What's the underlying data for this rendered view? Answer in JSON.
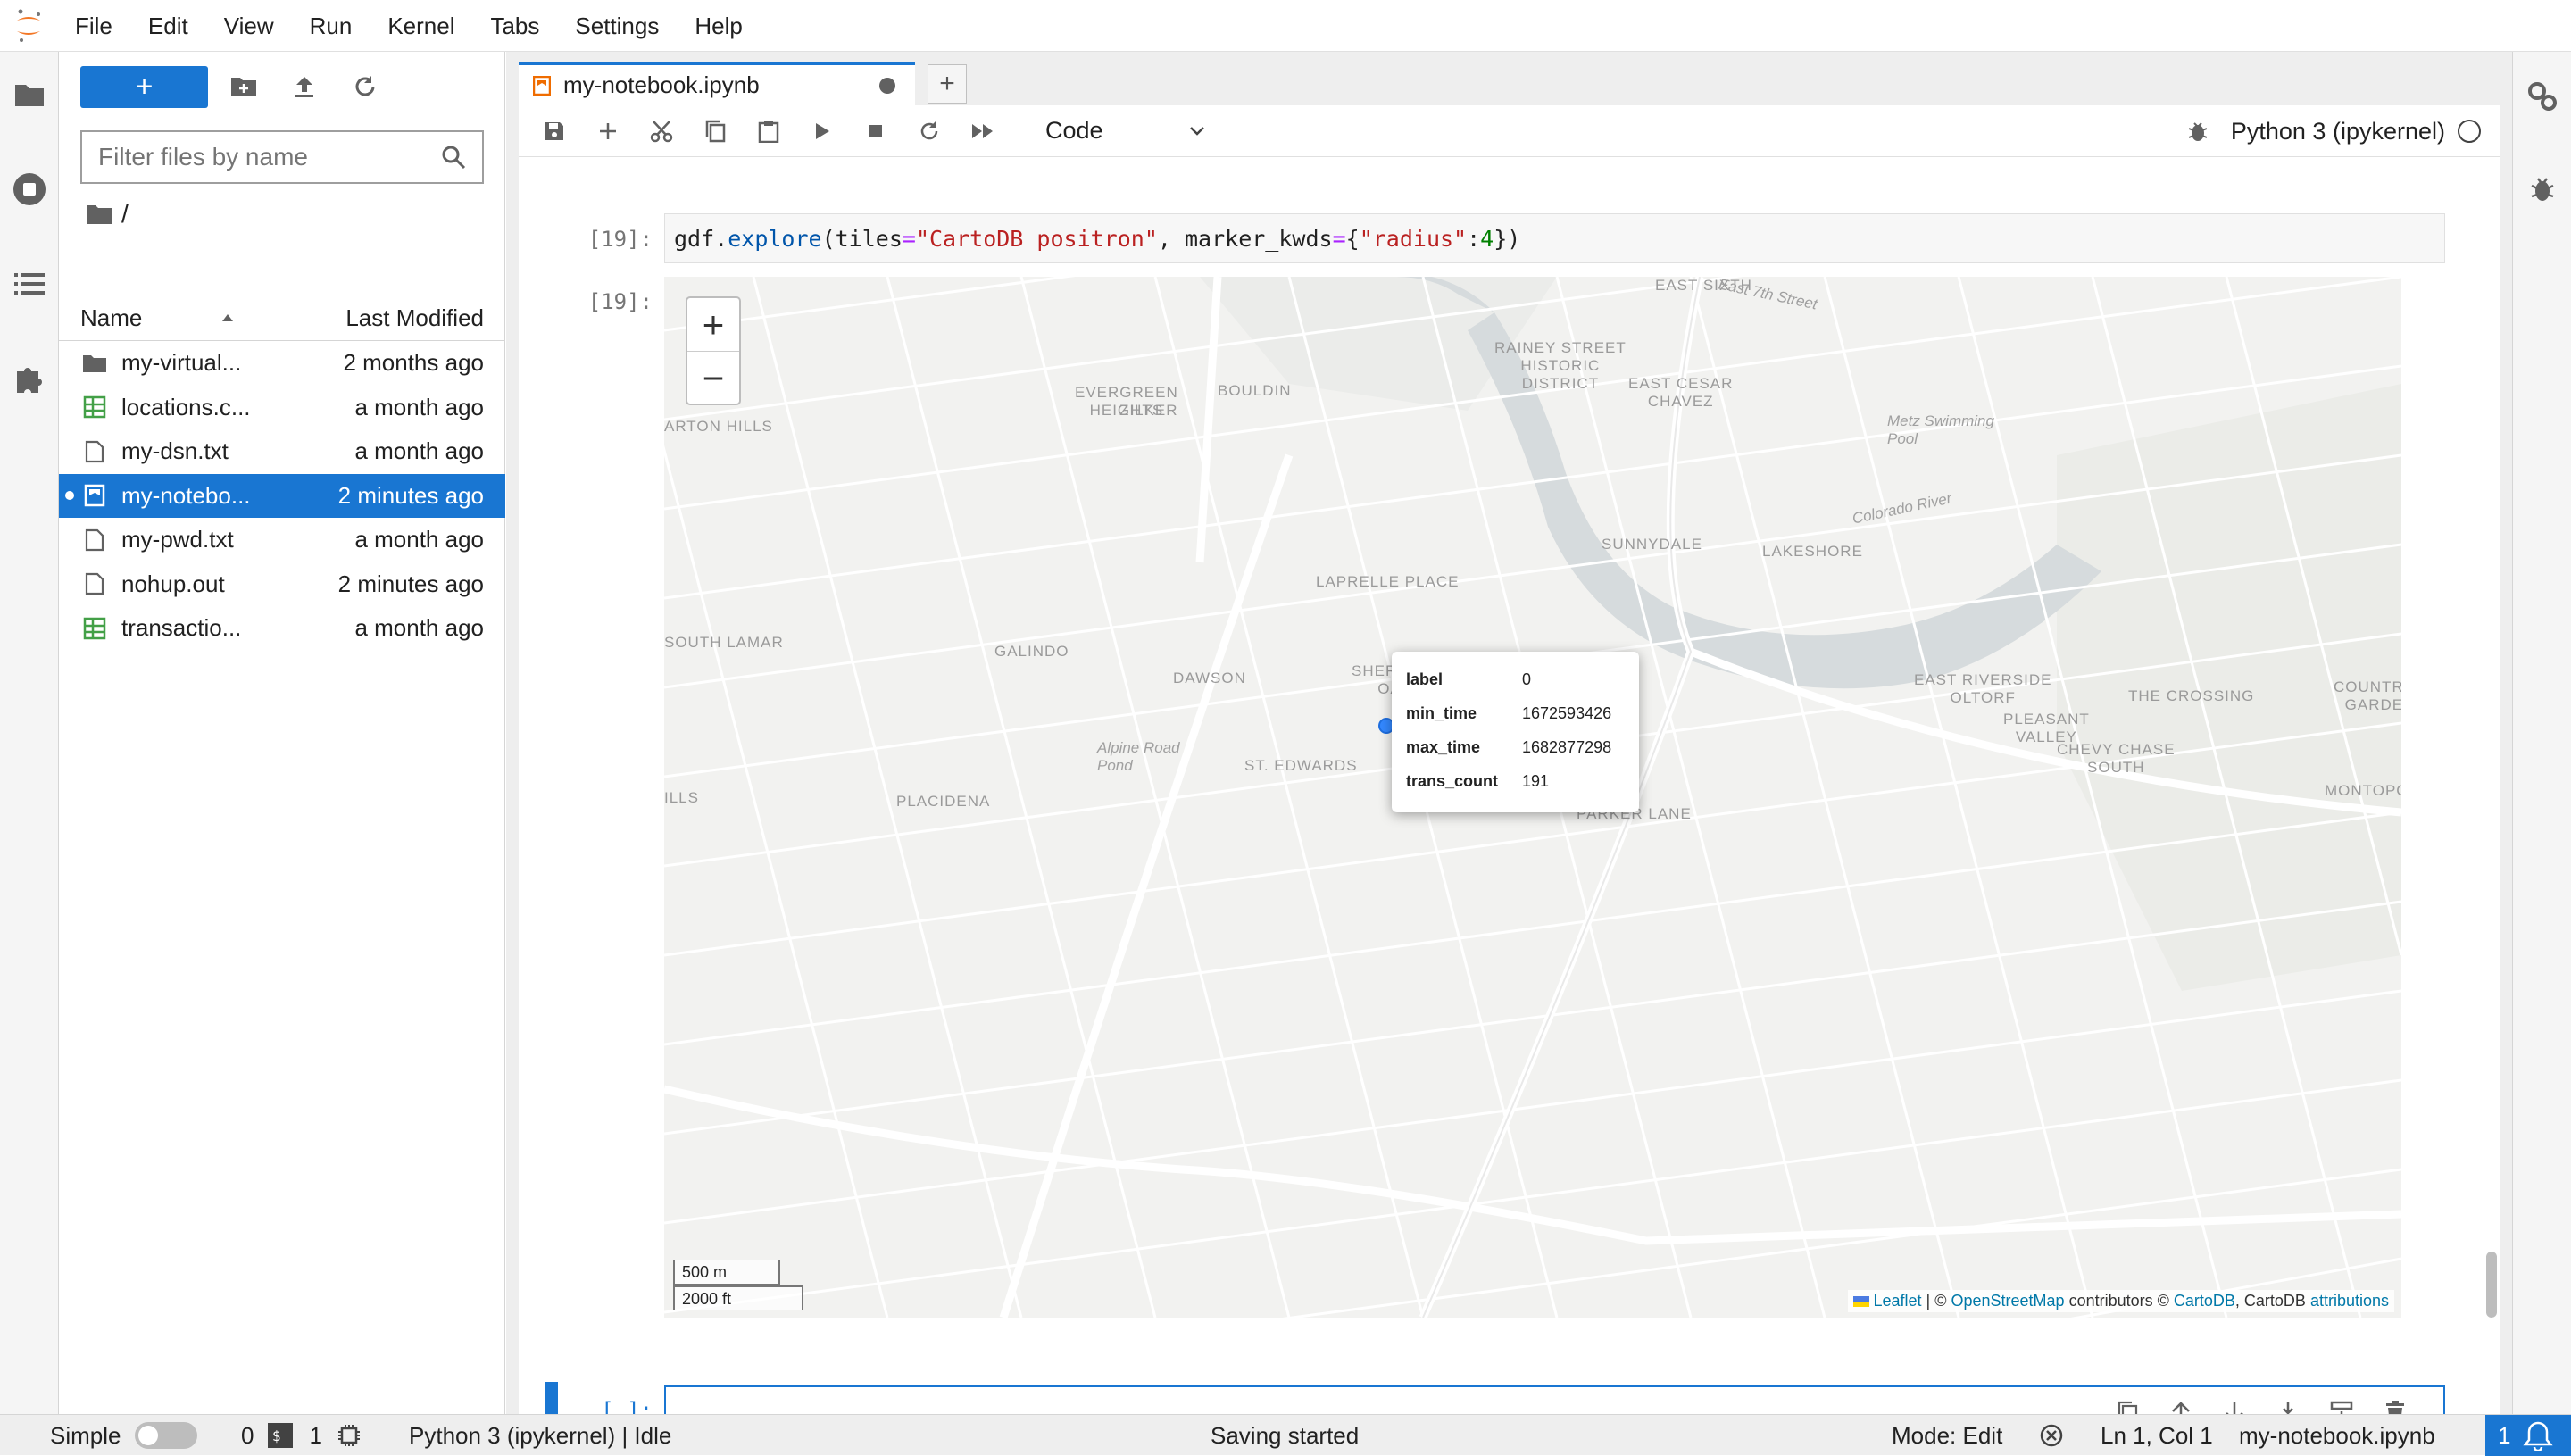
{
  "menubar": {
    "items": [
      "File",
      "Edit",
      "View",
      "Run",
      "Kernel",
      "Tabs",
      "Settings",
      "Help"
    ]
  },
  "left_sidebar": {
    "icons": [
      "folder-icon",
      "running-icon",
      "toc-icon",
      "extensions-icon"
    ]
  },
  "right_sidebar": {
    "icons": [
      "property-inspector-icon",
      "debugger-icon"
    ]
  },
  "file_browser": {
    "new_button": "+",
    "filter_placeholder": "Filter files by name",
    "breadcrumb": "/",
    "columns": {
      "name": "Name",
      "modified": "Last Modified"
    },
    "files": [
      {
        "name": "my-virtual...",
        "modified": "2 months ago",
        "icon": "folder-icon",
        "selected": false,
        "running": false
      },
      {
        "name": "locations.c...",
        "modified": "a month ago",
        "icon": "spreadsheet-icon",
        "selected": false,
        "running": false
      },
      {
        "name": "my-dsn.txt",
        "modified": "a month ago",
        "icon": "file-icon",
        "selected": false,
        "running": false
      },
      {
        "name": "my-notebo...",
        "modified": "2 minutes ago",
        "icon": "notebook-icon",
        "selected": true,
        "running": true
      },
      {
        "name": "my-pwd.txt",
        "modified": "a month ago",
        "icon": "file-icon",
        "selected": false,
        "running": false
      },
      {
        "name": "nohup.out",
        "modified": "2 minutes ago",
        "icon": "file-icon",
        "selected": false,
        "running": false
      },
      {
        "name": "transactio...",
        "modified": "a month ago",
        "icon": "spreadsheet-icon",
        "selected": false,
        "running": false
      }
    ]
  },
  "tabs": {
    "active_title": "my-notebook.ipynb",
    "add_label": "+"
  },
  "notebook_toolbar": {
    "cell_type": "Code",
    "kernel_name": "Python 3 (ipykernel)"
  },
  "cells": {
    "code_prompt": "[19]:",
    "output_prompt": "[19]:",
    "code_tokens": [
      {
        "t": "gdf.",
        "c": ""
      },
      {
        "t": "explore",
        "c": "tk-fn"
      },
      {
        "t": "(tiles",
        "c": ""
      },
      {
        "t": "=",
        "c": "tk-op"
      },
      {
        "t": "\"CartoDB positron\"",
        "c": "tk-str"
      },
      {
        "t": ", marker_kwds",
        "c": ""
      },
      {
        "t": "=",
        "c": "tk-op"
      },
      {
        "t": "{",
        "c": ""
      },
      {
        "t": "\"radius\"",
        "c": "tk-str"
      },
      {
        "t": ":",
        "c": ""
      },
      {
        "t": "4",
        "c": "tk-num"
      },
      {
        "t": "})",
        "c": ""
      }
    ],
    "empty_prompt": "[ ]:"
  },
  "map": {
    "zoom_in": "+",
    "zoom_out": "−",
    "labels": [
      {
        "text": "EAST SIXTH",
        "style": "map-label"
      },
      {
        "text": "East 7th Street",
        "style": "map-italic"
      },
      {
        "text": "RAINEY STREET\nHISTORIC\nDISTRICT",
        "style": "map-label"
      },
      {
        "text": "EAST CESAR\nCHAVEZ",
        "style": "map-label"
      },
      {
        "text": "EVERGREEN\nHEIGHTS",
        "style": "map-label"
      },
      {
        "text": "BOULDIN",
        "style": "map-label"
      },
      {
        "text": "ZILKER",
        "style": "map-label"
      },
      {
        "text": "ARTON HILLS",
        "style": "map-label"
      },
      {
        "text": "Metz Swimming\nPool",
        "style": "map-italic"
      },
      {
        "text": "SUNNYDALE",
        "style": "map-label"
      },
      {
        "text": "LAKESHORE",
        "style": "map-label"
      },
      {
        "text": "LAPRELLE PLACE",
        "style": "map-label"
      },
      {
        "text": "SOUTH LAMAR",
        "style": "map-label"
      },
      {
        "text": "GALINDO",
        "style": "map-label"
      },
      {
        "text": "DAWSON",
        "style": "map-label"
      },
      {
        "text": "SHERWOOD\nOAKS",
        "style": "map-label"
      },
      {
        "text": "EAST RIVERSIDE\nOLTORF",
        "style": "map-label"
      },
      {
        "text": "THE CROSSING",
        "style": "map-label"
      },
      {
        "text": "COUNTRY\nGARDE",
        "style": "map-label"
      },
      {
        "text": "PLEASANT\nVALLEY",
        "style": "map-label"
      },
      {
        "text": "CHEVY CHASE\nSOUTH",
        "style": "map-label"
      },
      {
        "text": "Alpine Road\nPond",
        "style": "map-italic"
      },
      {
        "text": "ST. EDWARDS",
        "style": "map-label"
      },
      {
        "text": "PLACIDENA",
        "style": "map-label"
      },
      {
        "text": "PARKER LANE",
        "style": "map-label"
      },
      {
        "text": "MONTOPC",
        "style": "map-label"
      },
      {
        "text": "ILLS",
        "style": "map-label"
      },
      {
        "text": "Colorado River",
        "style": "map-italic"
      }
    ],
    "popup": {
      "rows": [
        {
          "key": "label",
          "value": "0"
        },
        {
          "key": "min_time",
          "value": "1672593426"
        },
        {
          "key": "max_time",
          "value": "1682877298"
        },
        {
          "key": "trans_count",
          "value": "191"
        }
      ]
    },
    "scale": {
      "metric": "500 m",
      "imperial": "2000 ft"
    },
    "attribution": {
      "leaflet": "Leaflet",
      "sep1": " | © ",
      "osm": "OpenStreetMap",
      "mid": " contributors © ",
      "carto": "CartoDB",
      "mid2": ", CartoDB ",
      "attr": "attributions"
    },
    "colors": {
      "water": "#d4dadc",
      "park": "#e8ebe6",
      "road": "#ffffff",
      "marker": "#3388ff"
    }
  },
  "statusbar": {
    "mode_simple": "Simple",
    "terminals": "0",
    "kernels": "1",
    "kernel_status": "Python 3 (ipykernel) | Idle",
    "saving": "Saving started",
    "mode": "Mode: Edit",
    "position": "Ln 1, Col 1",
    "filename": "my-notebook.ipynb",
    "notifications": "1"
  }
}
